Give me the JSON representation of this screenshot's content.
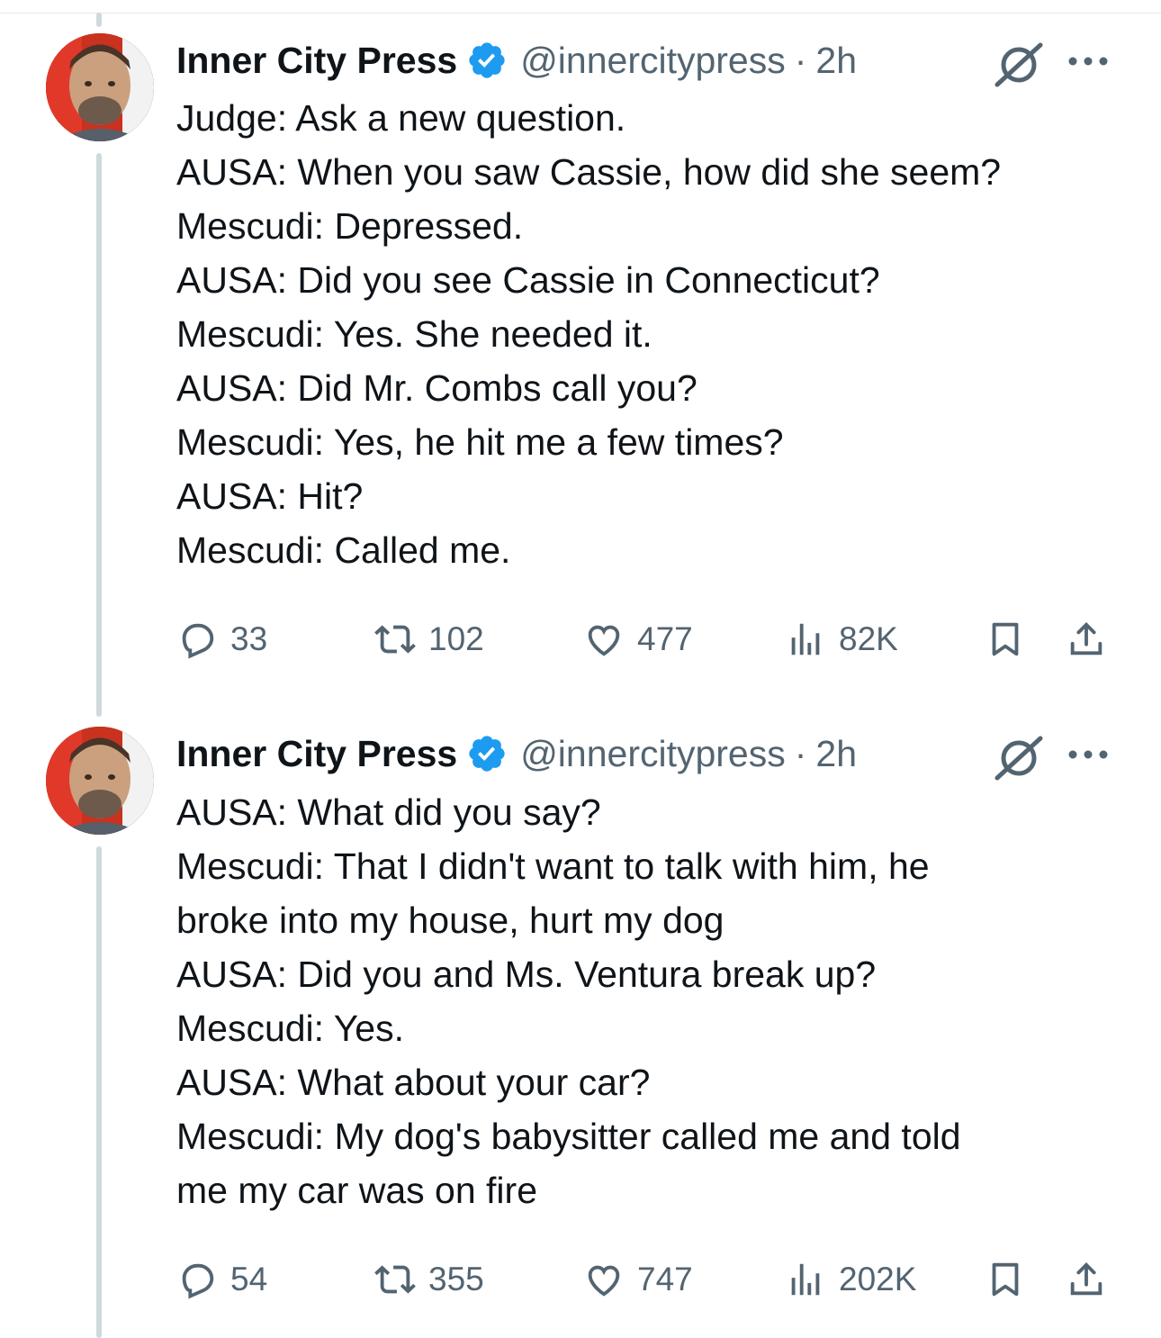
{
  "tweets": [
    {
      "author_name": "Inner City Press",
      "handle": "@innercitypress",
      "separator": "·",
      "time": "2h",
      "lines": [
        "Judge: Ask a new question.",
        "AUSA: When you saw Cassie, how did she seem?",
        "Mescudi: Depressed.",
        "AUSA: Did you see Cassie in Connecticut?",
        "Mescudi: Yes. She needed it.",
        "AUSA: Did Mr. Combs call you?",
        "Mescudi: Yes, he hit me a few times?",
        "AUSA: Hit?",
        "Mescudi: Called me."
      ],
      "stats": {
        "replies": "33",
        "reposts": "102",
        "likes": "477",
        "views": "82K"
      }
    },
    {
      "author_name": "Inner City Press",
      "handle": "@innercitypress",
      "separator": "·",
      "time": "2h",
      "lines": [
        "AUSA: What did you say?",
        "Mescudi: That I didn't want to talk with him, he",
        "broke into my house, hurt my dog",
        "AUSA: Did you and Ms. Ventura break up?",
        "Mescudi: Yes.",
        "AUSA: What about your car?",
        "Mescudi: My dog's babysitter called me and told",
        "me my car was on fire"
      ],
      "stats": {
        "replies": "54",
        "reposts": "355",
        "likes": "747",
        "views": "202K"
      }
    }
  ],
  "colors": {
    "text": "#0f1419",
    "secondary": "#536471",
    "verified": "#1d9bf0",
    "thread_line": "#cfd9de"
  },
  "icons": [
    "verified-badge-icon",
    "grok-icon",
    "more-icon",
    "reply-icon",
    "repost-icon",
    "like-icon",
    "views-icon",
    "bookmark-icon",
    "share-icon"
  ]
}
